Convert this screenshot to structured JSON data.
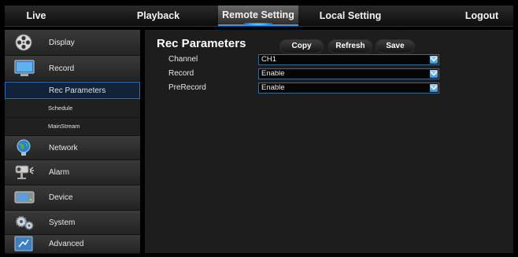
{
  "nav": {
    "tabs": [
      {
        "label": "Live"
      },
      {
        "label": "Playback"
      },
      {
        "label": "Remote Setting"
      },
      {
        "label": "Local Setting"
      },
      {
        "label": "Logout"
      }
    ],
    "active_tab": "Remote Setting"
  },
  "sidebar": {
    "items": [
      {
        "label": "Display",
        "icon": "film-reel-icon"
      },
      {
        "label": "Record",
        "icon": "monitor-icon"
      },
      {
        "label": "Network",
        "icon": "globe-icon"
      },
      {
        "label": "Alarm",
        "icon": "camera-alarm-icon"
      },
      {
        "label": "Device",
        "icon": "hard-drive-icon"
      },
      {
        "label": "System",
        "icon": "gears-icon"
      },
      {
        "label": "Advanced",
        "icon": "advanced-icon"
      }
    ],
    "record_submenu": [
      {
        "label": "Rec Parameters",
        "active": true
      },
      {
        "label": "Schedule"
      },
      {
        "label": "MainStream"
      }
    ]
  },
  "content": {
    "title": "Rec Parameters",
    "buttons": {
      "copy": "Copy",
      "refresh": "Refresh",
      "save": "Save"
    },
    "fields": [
      {
        "label": "Channel",
        "value": "CH1"
      },
      {
        "label": "Record",
        "value": "Enable"
      },
      {
        "label": "PreRecord",
        "value": "Enable"
      }
    ]
  },
  "colors": {
    "accent": "#1fa0ff",
    "active_submenu_bg": "#10233a",
    "select_border": "#3a6b8c"
  }
}
